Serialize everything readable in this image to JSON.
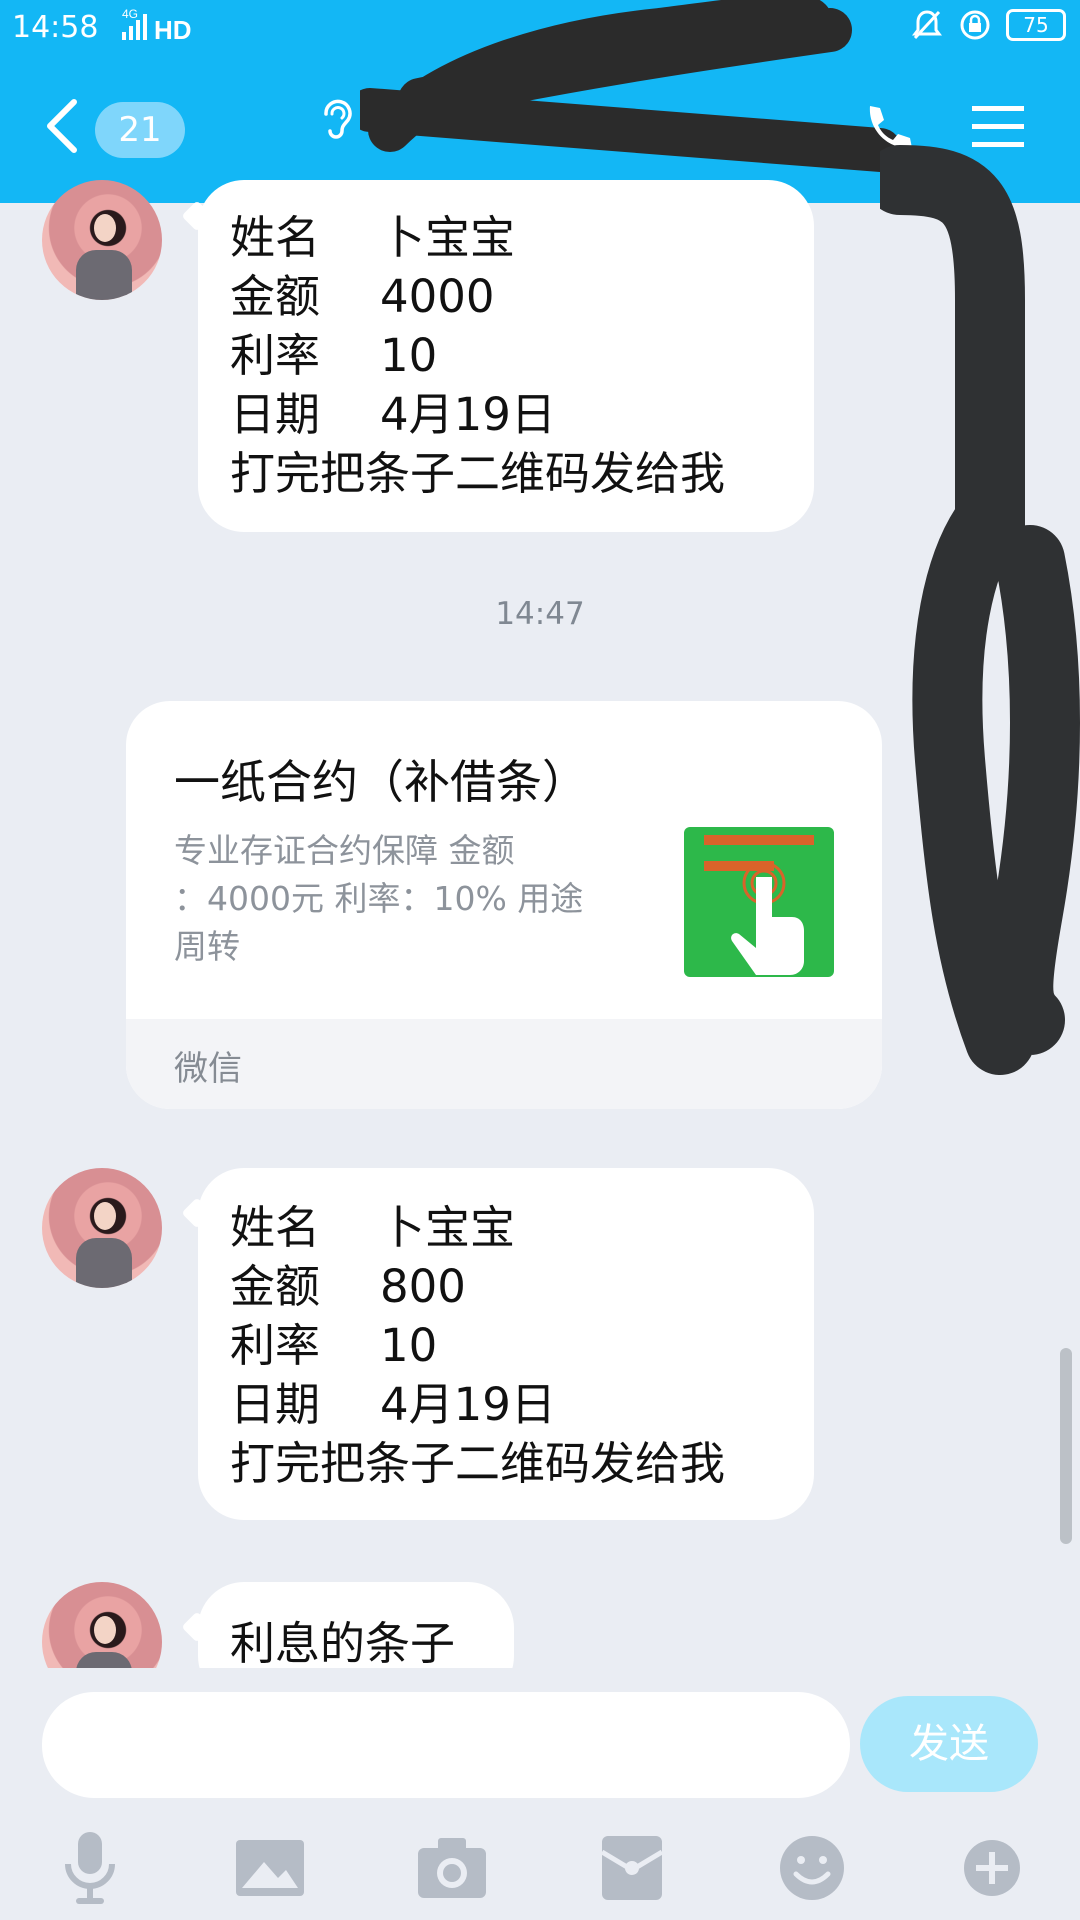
{
  "status": {
    "time": "14:58",
    "network": "4G",
    "hd": "HD",
    "battery": "75"
  },
  "header": {
    "unread_count": "21"
  },
  "messages": [
    {
      "lines": [
        [
          "姓名",
          "卜宝宝"
        ],
        [
          "金额",
          "4000"
        ],
        [
          "利率",
          "10"
        ],
        [
          "日期",
          "4月19日"
        ]
      ],
      "note": "打完把条子二维码发给我"
    },
    {
      "time": "14:47"
    },
    {
      "card": {
        "title": "一纸合约（补借条）",
        "desc_line1": "专业存证合约保障 金额",
        "desc_line2": "：4000元 利率：10% 用途",
        "desc_line3": "周转",
        "source": "微信"
      }
    },
    {
      "lines": [
        [
          "姓名",
          "卜宝宝"
        ],
        [
          "金额",
          "800"
        ],
        [
          "利率",
          "10"
        ],
        [
          "日期",
          "4月19日"
        ]
      ],
      "note": "打完把条子二维码发给我"
    },
    {
      "text": "利息的条子"
    }
  ],
  "composer": {
    "placeholder": "",
    "send_label": "发送"
  },
  "toolbar_icons": [
    "microphone-icon",
    "image-icon",
    "camera-icon",
    "red-packet-icon",
    "emoji-icon",
    "plus-icon"
  ],
  "colors": {
    "header": "#13b7f5",
    "background": "#eaedf3",
    "send_disabled": "#a9e7fb"
  }
}
